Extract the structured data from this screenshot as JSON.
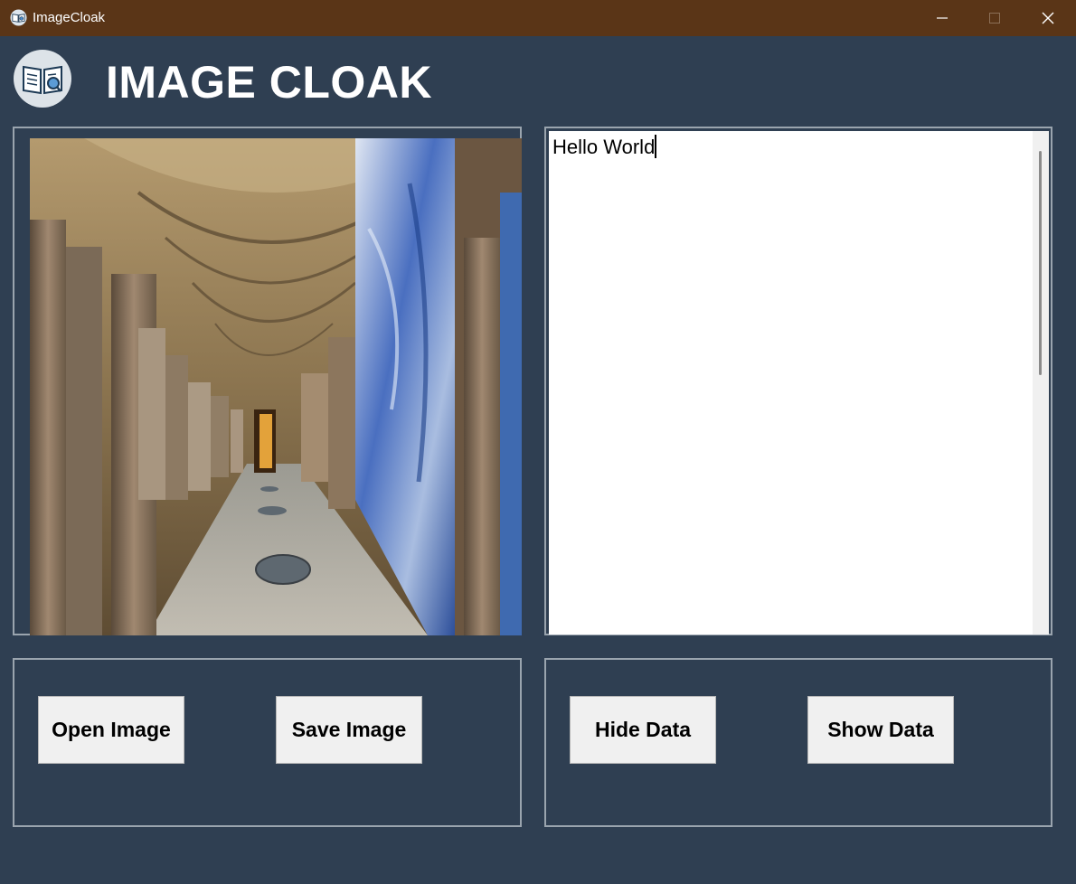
{
  "window": {
    "title": "ImageCloak",
    "titlebar_color": "#5a3517",
    "background_color": "#2f3f52"
  },
  "header": {
    "logo_icon": "book-search-icon",
    "app_title": "IMAGE CLOAK"
  },
  "text_panel": {
    "content": "Hello World"
  },
  "image_panel": {
    "image_description_icon": "photo-icon"
  },
  "buttons": {
    "open_image": "Open Image",
    "save_image": "Save Image",
    "hide_data": "Hide Data",
    "show_data": "Show Data"
  }
}
